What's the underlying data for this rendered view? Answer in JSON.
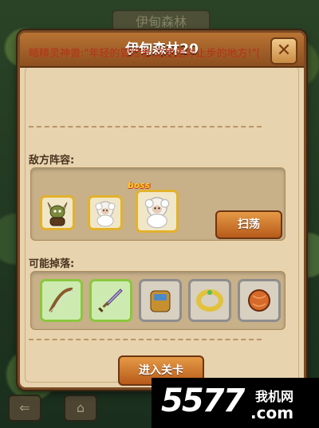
{
  "background_title": "伊甸森林",
  "dialog": {
    "title": "伊甸森林20",
    "close_label": "✕",
    "quote": "暗精灵神兽:\"年轻的冒险者,这里是你止步的地方!\"[",
    "enemy_label": "敌方阵容:",
    "drops_label": "可能掉落:",
    "boss_tag": "boss",
    "sweep_label": "扫荡",
    "enter_label": "进入关卡"
  },
  "enemies": [
    {
      "name": "horned-goblin-icon"
    },
    {
      "name": "white-sheep-icon"
    },
    {
      "name": "white-sheep-boss-icon"
    }
  ],
  "drops": [
    {
      "name": "bow-icon",
      "rarity": "green"
    },
    {
      "name": "sword-icon",
      "rarity": "green"
    },
    {
      "name": "bracer-icon",
      "rarity": "gray"
    },
    {
      "name": "ring-icon",
      "rarity": "gray"
    },
    {
      "name": "orb-icon",
      "rarity": "gray"
    }
  ],
  "watermark": {
    "number": "5577",
    "site": "我机网",
    "domain": ".com"
  },
  "colors": {
    "title_bar": "#a5622a",
    "panel": "#e7d3ad",
    "quote_text": "#b6311a",
    "button": "#d07a32"
  }
}
